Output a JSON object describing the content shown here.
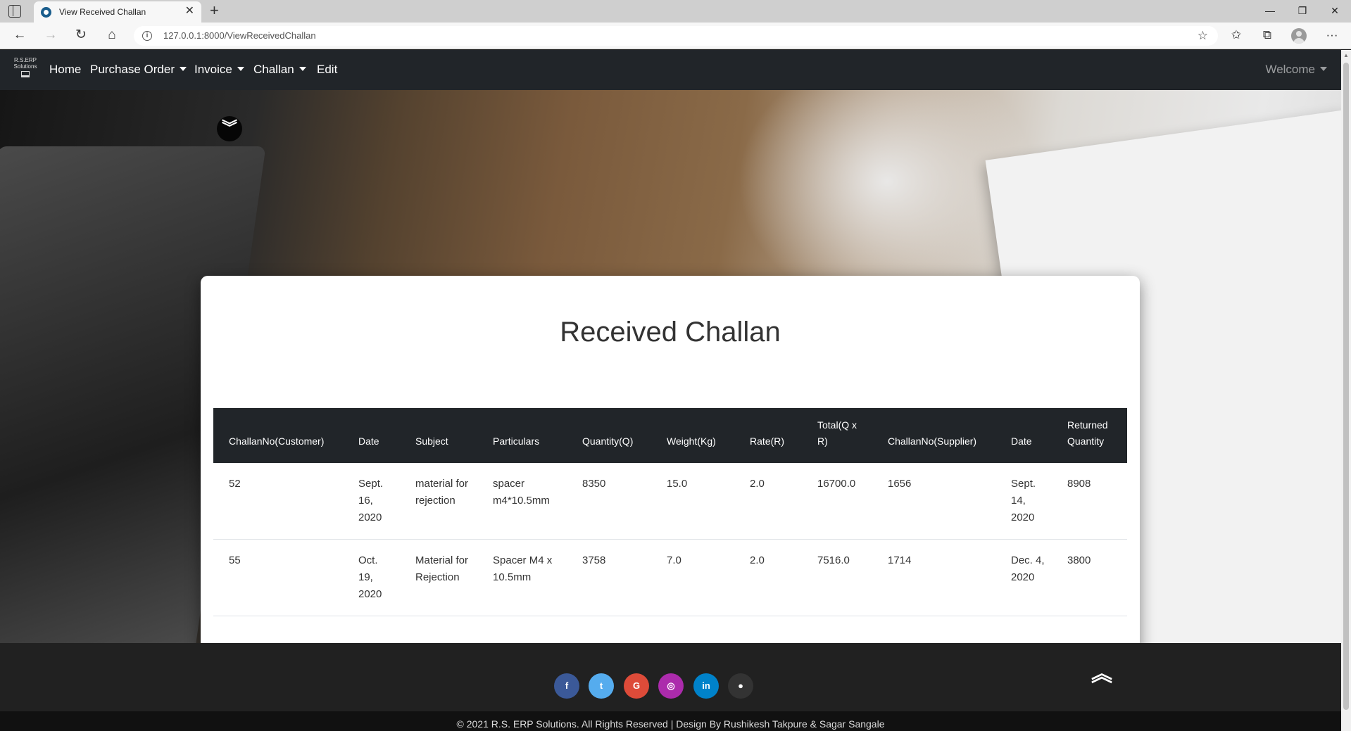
{
  "browser": {
    "tab_title": "View Received Challan",
    "tab_close": "✕",
    "new_tab": "+",
    "url": "127.0.0.1:8000/ViewReceivedChallan",
    "window_controls": {
      "minimize": "—",
      "restore": "❐",
      "close": "✕"
    },
    "nav_icons": {
      "back": "←",
      "forward": "→",
      "reload": "↻",
      "home": "⌂"
    },
    "toolbar_icons": {
      "favorites_add": "☆",
      "favorites": "✩",
      "collections": "⧉",
      "menu": "···"
    }
  },
  "navbar": {
    "brand_line1": "R.S.ERP",
    "brand_line2": "Solutions",
    "items": [
      {
        "label": "Home",
        "dropdown": false
      },
      {
        "label": "Purchase Order",
        "dropdown": true
      },
      {
        "label": "Invoice",
        "dropdown": true
      },
      {
        "label": "Challan",
        "dropdown": true
      },
      {
        "label": "Edit",
        "dropdown": false
      }
    ],
    "welcome": "Welcome"
  },
  "page": {
    "scroll_down_icon": "chevrons-down-icon",
    "title": "Received Challan"
  },
  "table": {
    "headers": [
      "ChallanNo(Customer)",
      "Date",
      "Subject",
      "Particulars",
      "Quantity(Q)",
      "Weight(Kg)",
      "Rate(R)",
      "Total(Q x R)",
      "ChallanNo(Supplier)",
      "Date",
      "Returned Quantity"
    ],
    "rows": [
      [
        "52",
        "Sept. 16, 2020",
        "material for rejection",
        "spacer m4*10.5mm",
        "8350",
        "15.0",
        "2.0",
        "16700.0",
        "1656",
        "Sept. 14, 2020",
        "8908"
      ],
      [
        "55",
        "Oct. 19, 2020",
        "Material for Rejection",
        "Spacer M4 x 10.5mm",
        "3758",
        "7.0",
        "2.0",
        "7516.0",
        "1714",
        "Dec. 4, 2020",
        "3800"
      ]
    ]
  },
  "footer": {
    "social": [
      {
        "name": "facebook",
        "glyph": "f",
        "color": "#3b5998"
      },
      {
        "name": "twitter",
        "glyph": "t",
        "color": "#55acee"
      },
      {
        "name": "google",
        "glyph": "G",
        "color": "#dd4b39"
      },
      {
        "name": "instagram",
        "glyph": "◎",
        "color": "#ac2bac"
      },
      {
        "name": "linkedin",
        "glyph": "in",
        "color": "#0082ca"
      },
      {
        "name": "github",
        "glyph": "●",
        "color": "#333333"
      }
    ],
    "scroll_top_glyph": "⌃",
    "copyright": "© 2021 R.S. ERP Solutions. All Rights Reserved | Design By Rushikesh Takpure & Sagar Sangale"
  }
}
